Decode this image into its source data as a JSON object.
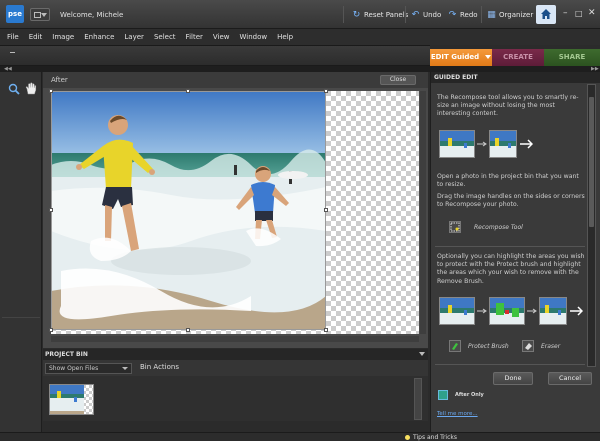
{
  "app": {
    "logo": "pse",
    "welcome": "Welcome, Michele"
  },
  "titlebar": {
    "reset_panels": "Reset Panels",
    "undo": "Undo",
    "redo": "Redo",
    "organizer": "Organizer"
  },
  "menu": [
    "File",
    "Edit",
    "Image",
    "Enhance",
    "Layer",
    "Select",
    "Filter",
    "View",
    "Window",
    "Help"
  ],
  "mode_tabs": {
    "edit": "EDIT Guided",
    "create": "CREATE",
    "share": "SHARE"
  },
  "document": {
    "view_label": "After",
    "close": "Close"
  },
  "project_bin": {
    "title": "PROJECT BIN",
    "show": "Show Open Files",
    "actions": "Bin Actions"
  },
  "guided_edit": {
    "title": "GUIDED EDIT",
    "intro": "The Recompose tool allows you to smartly re-size an image without losing the most interesting content.",
    "step1": "Open a photo in the project bin that you want to resize.",
    "step2": "Drag the image handles on the sides or corners to Recompose your photo.",
    "recompose_tool": "Recompose Tool",
    "step3": "Optionally you can highlight the areas you wish to protect with the Protect brush and highlight the areas which your wish to remove with the Remove Brush.",
    "protect_brush": "Protect Brush",
    "eraser": "Eraser",
    "done": "Done",
    "cancel": "Cancel",
    "after_only": "After Only",
    "tell_me_more": "Tell me more..."
  },
  "status": {
    "tips": "Tips and Tricks"
  },
  "colors": {
    "edit_tab": "#f08a28",
    "create_tab": "#6a2240",
    "share_tab": "#35602a",
    "accent_blue": "#2a7ad0"
  }
}
